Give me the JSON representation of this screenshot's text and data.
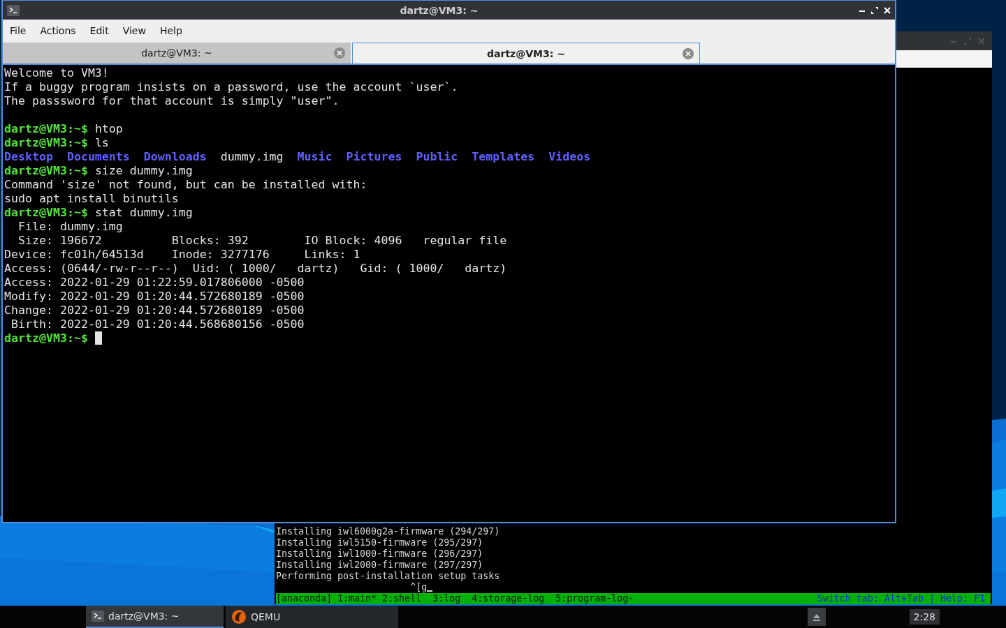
{
  "terminal_window": {
    "title": "dartz@VM3: ~",
    "menu": [
      "File",
      "Actions",
      "Edit",
      "View",
      "Help"
    ],
    "tabs": [
      {
        "label": "dartz@VM3: ~",
        "selected": false
      },
      {
        "label": "dartz@VM3: ~",
        "selected": true
      }
    ],
    "lines": [
      {
        "kind": "text",
        "segments": [
          {
            "text": "Welcome to VM3!",
            "kind": "plain"
          }
        ]
      },
      {
        "kind": "text",
        "segments": [
          {
            "text": "If a buggy program insists on a password, use the account `user`.",
            "kind": "plain"
          }
        ]
      },
      {
        "kind": "text",
        "segments": [
          {
            "text": "The passsword for that account is simply \"user\".",
            "kind": "plain"
          }
        ]
      },
      {
        "kind": "blank"
      },
      {
        "kind": "text",
        "segments": [
          {
            "text": "dartz@VM3:~$",
            "kind": "prompt"
          },
          {
            "text": "htop",
            "kind": "command"
          }
        ]
      },
      {
        "kind": "text",
        "segments": [
          {
            "text": "dartz@VM3:~$",
            "kind": "prompt"
          },
          {
            "text": "ls",
            "kind": "command"
          }
        ]
      },
      {
        "kind": "columns",
        "segments": [
          {
            "text": "Desktop",
            "kind": "dir"
          },
          {
            "text": "Documents",
            "kind": "dir"
          },
          {
            "text": "Downloads",
            "kind": "dir"
          },
          {
            "text": "dummy.img",
            "kind": "plain"
          },
          {
            "text": "Music",
            "kind": "dir"
          },
          {
            "text": "Pictures",
            "kind": "dir"
          },
          {
            "text": "Public",
            "kind": "dir"
          },
          {
            "text": "Templates",
            "kind": "dir"
          },
          {
            "text": "Videos",
            "kind": "dir"
          }
        ]
      },
      {
        "kind": "text",
        "segments": [
          {
            "text": "dartz@VM3:~$",
            "kind": "prompt"
          },
          {
            "text": "size dummy.img",
            "kind": "command"
          }
        ]
      },
      {
        "kind": "text",
        "segments": [
          {
            "text": "Command 'size' not found, but can be installed with:",
            "kind": "plain"
          }
        ]
      },
      {
        "kind": "text",
        "segments": [
          {
            "text": "sudo apt install binutils",
            "kind": "plain"
          }
        ]
      },
      {
        "kind": "text",
        "segments": [
          {
            "text": "dartz@VM3:~$",
            "kind": "prompt"
          },
          {
            "text": "stat dummy.img",
            "kind": "command"
          }
        ]
      },
      {
        "kind": "text",
        "segments": [
          {
            "text": "  File: dummy.img",
            "kind": "plain"
          }
        ]
      },
      {
        "kind": "text",
        "segments": [
          {
            "text": "  Size: 196672          Blocks: 392        IO Block: 4096   regular file",
            "kind": "plain"
          }
        ]
      },
      {
        "kind": "text",
        "segments": [
          {
            "text": "Device: fc01h/64513d    Inode: 3277176     Links: 1",
            "kind": "plain"
          }
        ]
      },
      {
        "kind": "text",
        "segments": [
          {
            "text": "Access: (0644/-rw-r--r--)  Uid: ( 1000/   dartz)   Gid: ( 1000/   dartz)",
            "kind": "plain"
          }
        ]
      },
      {
        "kind": "text",
        "segments": [
          {
            "text": "Access: 2022-01-29 01:22:59.017806000 -0500",
            "kind": "plain"
          }
        ]
      },
      {
        "kind": "text",
        "segments": [
          {
            "text": "Modify: 2022-01-29 01:20:44.572680189 -0500",
            "kind": "plain"
          }
        ]
      },
      {
        "kind": "text",
        "segments": [
          {
            "text": "Change: 2022-01-29 01:20:44.572680189 -0500",
            "kind": "plain"
          }
        ]
      },
      {
        "kind": "text",
        "segments": [
          {
            "text": " Birth: 2022-01-29 01:20:44.568680156 -0500",
            "kind": "plain"
          }
        ]
      },
      {
        "kind": "text",
        "segments": [
          {
            "text": "dartz@VM3:~$",
            "kind": "prompt"
          }
        ],
        "cursor": true
      }
    ]
  },
  "qemu_window": {
    "lines": [
      {
        "kind": "text",
        "text": "Installing iwl6000g2a-firmware (294/297)"
      },
      {
        "kind": "text",
        "text": "Installing iwl5150-firmware (295/297)"
      },
      {
        "kind": "text",
        "text": "Installing iwl1000-firmware (296/297)"
      },
      {
        "kind": "text",
        "text": "Installing iwl2000-firmware (297/297)"
      },
      {
        "kind": "text",
        "text": "Performing post-installation setup tasks"
      },
      {
        "kind": "echo",
        "text": "^[g",
        "cursor": true
      }
    ],
    "status_bar": {
      "left": "[anaconda] 1:main* 2:shell  3:log  4:storage-log  5:program-log-",
      "right": "Switch tab: Alt+Tab | Help: F1"
    }
  },
  "taskbar": {
    "tasks": [
      {
        "label": "dartz@VM3: ~",
        "kind": "terminal",
        "selected": true
      },
      {
        "label": "QEMU",
        "kind": "qemu",
        "selected": false
      }
    ],
    "clock": "2:28"
  }
}
